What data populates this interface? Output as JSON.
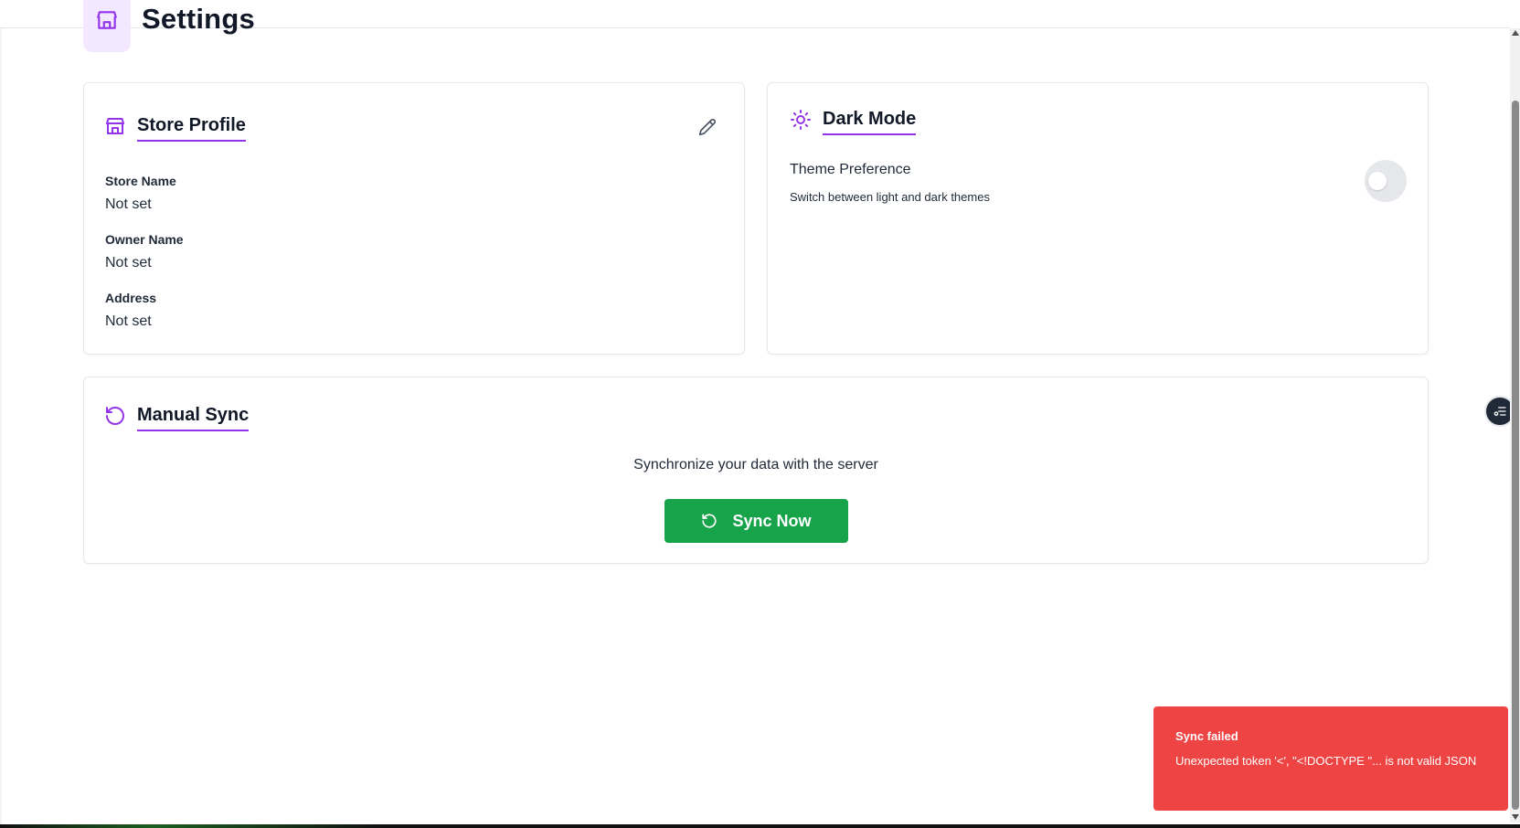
{
  "header": {
    "title": "Settings",
    "icon": "store-icon"
  },
  "store_profile": {
    "title": "Store Profile",
    "icon": "store-icon",
    "edit_icon": "pencil-icon",
    "fields": [
      {
        "label": "Store Name",
        "value": "Not set"
      },
      {
        "label": "Owner Name",
        "value": "Not set"
      },
      {
        "label": "Address",
        "value": "Not set"
      }
    ]
  },
  "dark_mode": {
    "title": "Dark Mode",
    "icon": "sun-icon",
    "preference_title": "Theme Preference",
    "preference_description": "Switch between light and dark themes",
    "toggle_on": false
  },
  "manual_sync": {
    "title": "Manual Sync",
    "icon": "refresh-icon",
    "description": "Synchronize your data with the server",
    "button_label": "Sync Now"
  },
  "toast": {
    "title": "Sync failed",
    "message": "Unexpected token '<', \"<!DOCTYPE \"... is not valid JSON"
  },
  "colors": {
    "accent": "#9333ea",
    "success": "#16a34a",
    "error": "#ef4444"
  }
}
